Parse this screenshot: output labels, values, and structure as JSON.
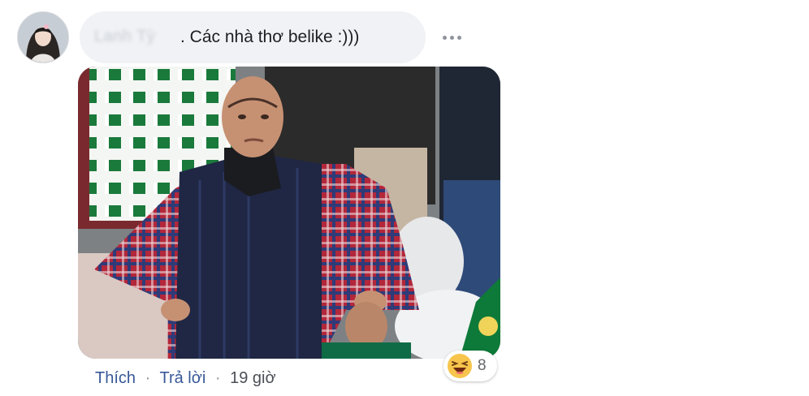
{
  "comment": {
    "author_name": "Lanh Tỳ",
    "text": ". Các nhà thơ belike :)))",
    "more_icon": "ellipsis-icon"
  },
  "photo": {
    "subject": "meme-photo"
  },
  "actions": {
    "like_label": "Thích",
    "reply_label": "Trả lời",
    "separator": "·",
    "time": "19 giờ"
  },
  "reactions": {
    "icon": "haha-icon",
    "count": "8"
  },
  "colors": {
    "bubble": "#f0f2f5",
    "link": "#385898",
    "text": "#1c1e21",
    "muted": "#65676b"
  }
}
